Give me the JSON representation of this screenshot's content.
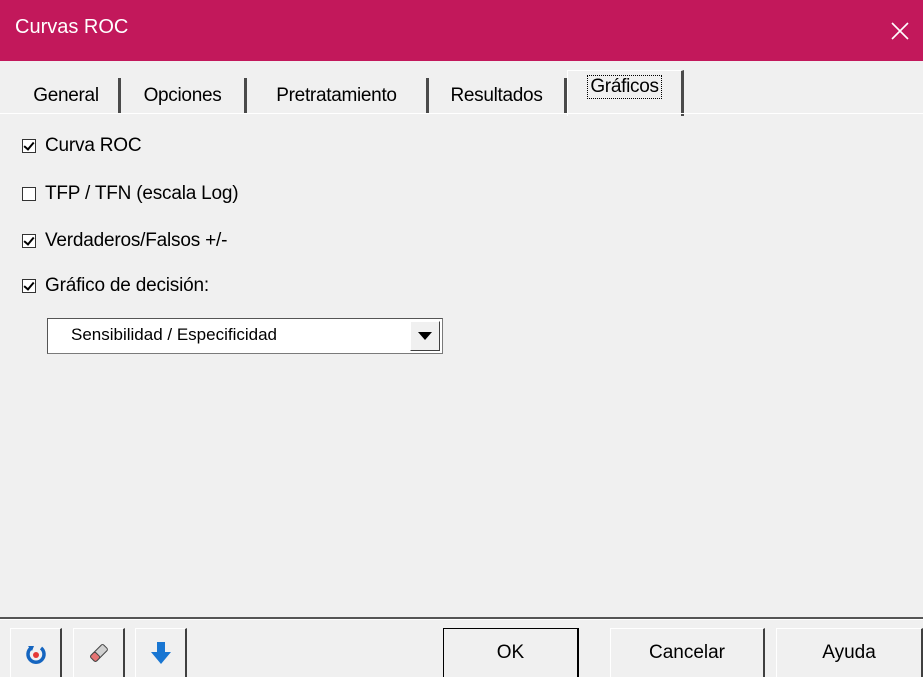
{
  "window": {
    "title": "Curvas ROC",
    "title_bar_color": "#c2185b"
  },
  "tabs": [
    {
      "label": "General",
      "active": false
    },
    {
      "label": "Opciones",
      "active": false
    },
    {
      "label": "Pretratamiento",
      "active": false
    },
    {
      "label": "Resultados",
      "active": false
    },
    {
      "label": "Gráficos",
      "active": true
    }
  ],
  "options": [
    {
      "label": "Curva ROC",
      "checked": true
    },
    {
      "label": "TFP / TFN (escala Log)",
      "checked": false
    },
    {
      "label": "Verdaderos/Falsos +/-",
      "checked": true
    },
    {
      "label": "Gráfico de decisión:",
      "checked": true
    }
  ],
  "decision_chart_select": {
    "value": "Sensibilidad / Especificidad"
  },
  "footer": {
    "icons": [
      "refresh-icon",
      "eraser-icon",
      "down-arrow-icon"
    ],
    "ok_label": "OK",
    "cancel_label": "Cancelar",
    "help_label": "Ayuda"
  }
}
